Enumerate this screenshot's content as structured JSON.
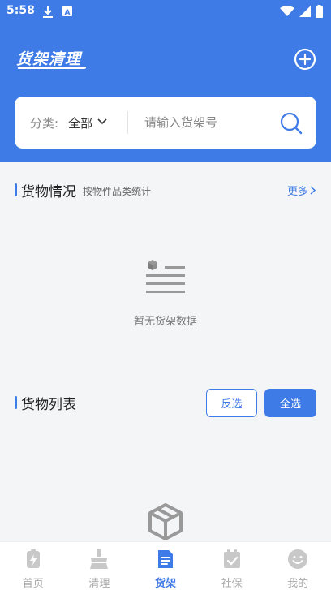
{
  "status_bar": {
    "time": "5:58"
  },
  "header": {
    "title": "货架清理"
  },
  "filter": {
    "category_label": "分类:",
    "category_value": "全部",
    "search_placeholder": "请输入货架号"
  },
  "goods_status": {
    "title": "货物情况",
    "subtitle": "按物件品类统计",
    "more_label": "更多",
    "empty_text": "暂无货架数据"
  },
  "goods_list": {
    "title": "货物列表",
    "invert_label": "反选",
    "select_all_label": "全选"
  },
  "tabbar": {
    "active_color": "#3e7be6",
    "items": [
      {
        "label": "首页",
        "icon": "home-bolt-icon"
      },
      {
        "label": "清理",
        "icon": "broom-icon"
      },
      {
        "label": "货架",
        "icon": "document-icon",
        "active": true
      },
      {
        "label": "社保",
        "icon": "calendar-check-icon"
      },
      {
        "label": "我的",
        "icon": "smiley-face-icon"
      }
    ]
  }
}
